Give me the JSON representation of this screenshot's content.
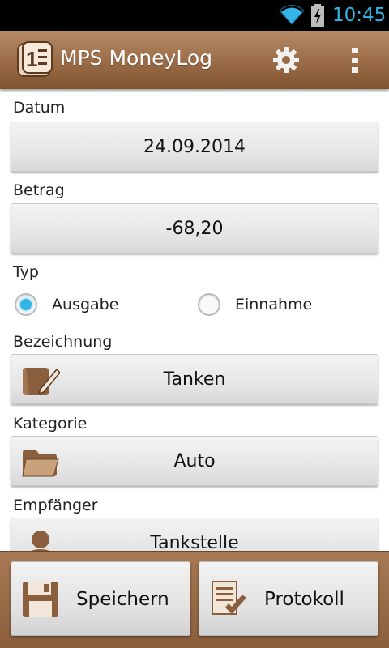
{
  "status_bar": {
    "time": "10:45"
  },
  "app": {
    "title": "MPS MoneyLog"
  },
  "form": {
    "datum": {
      "label": "Datum",
      "value": "24.09.2014"
    },
    "betrag": {
      "label": "Betrag",
      "value": "-68,20"
    },
    "typ": {
      "label": "Typ",
      "options": [
        {
          "label": "Ausgabe",
          "checked": true
        },
        {
          "label": "Einnahme",
          "checked": false
        }
      ]
    },
    "bezeichnung": {
      "label": "Bezeichnung",
      "value": "Tanken",
      "icon": "edit-note-icon"
    },
    "kategorie": {
      "label": "Kategorie",
      "value": "Auto",
      "icon": "folder-icon"
    },
    "empfaenger": {
      "label": "Empfänger",
      "value": "Tankstelle",
      "icon": "person-icon"
    }
  },
  "bottom": {
    "save_label": "Speichern",
    "protocol_label": "Protokoll"
  },
  "colors": {
    "accent": "#33b5e5",
    "brand_brown": "#9a6b47"
  }
}
